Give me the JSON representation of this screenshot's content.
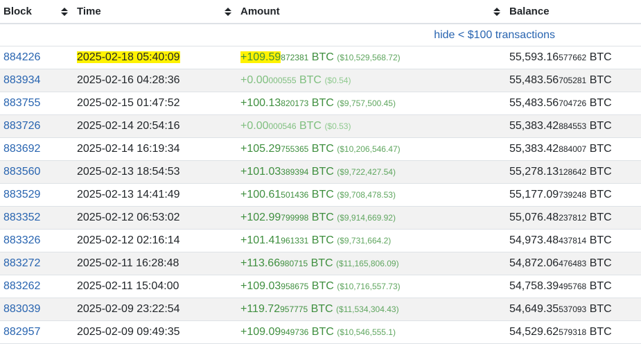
{
  "columns": {
    "block": "Block",
    "time": "Time",
    "amount": "Amount",
    "balance": "Balance"
  },
  "hide_link": "hide < $100 transactions",
  "rows": [
    {
      "block": "884226",
      "time": "2025-02-18 05:40:09",
      "amt_main": "+109.59",
      "amt_small": "872381",
      "unit": "BTC",
      "usd": "($10,529,568.72)",
      "bal_main": "55,593.16",
      "bal_small": "577662",
      "bal_unit": "BTC",
      "highlighted": true
    },
    {
      "block": "883934",
      "time": "2025-02-16 04:28:36",
      "amt_main": "+0.00",
      "amt_small": "000555",
      "unit": "BTC",
      "usd": "($0.54)",
      "bal_main": "55,483.56",
      "bal_small": "705281",
      "bal_unit": "BTC"
    },
    {
      "block": "883755",
      "time": "2025-02-15 01:47:52",
      "amt_main": "+100.13",
      "amt_small": "820173",
      "unit": "BTC",
      "usd": "($9,757,500.45)",
      "bal_main": "55,483.56",
      "bal_small": "704726",
      "bal_unit": "BTC"
    },
    {
      "block": "883726",
      "time": "2025-02-14 20:54:16",
      "amt_main": "+0.00",
      "amt_small": "000546",
      "unit": "BTC",
      "usd": "($0.53)",
      "bal_main": "55,383.42",
      "bal_small": "884553",
      "bal_unit": "BTC"
    },
    {
      "block": "883692",
      "time": "2025-02-14 16:19:34",
      "amt_main": "+105.29",
      "amt_small": "755365",
      "unit": "BTC",
      "usd": "($10,206,546.47)",
      "bal_main": "55,383.42",
      "bal_small": "884007",
      "bal_unit": "BTC"
    },
    {
      "block": "883560",
      "time": "2025-02-13 18:54:53",
      "amt_main": "+101.03",
      "amt_small": "389394",
      "unit": "BTC",
      "usd": "($9,722,427.54)",
      "bal_main": "55,278.13",
      "bal_small": "128642",
      "bal_unit": "BTC"
    },
    {
      "block": "883529",
      "time": "2025-02-13 14:41:49",
      "amt_main": "+100.61",
      "amt_small": "501436",
      "unit": "BTC",
      "usd": "($9,708,478.53)",
      "bal_main": "55,177.09",
      "bal_small": "739248",
      "bal_unit": "BTC"
    },
    {
      "block": "883352",
      "time": "2025-02-12 06:53:02",
      "amt_main": "+102.99",
      "amt_small": "799998",
      "unit": "BTC",
      "usd": "($9,914,669.92)",
      "bal_main": "55,076.48",
      "bal_small": "237812",
      "bal_unit": "BTC"
    },
    {
      "block": "883326",
      "time": "2025-02-12 02:16:14",
      "amt_main": "+101.41",
      "amt_small": "961331",
      "unit": "BTC",
      "usd": "($9,731,664.2)",
      "bal_main": "54,973.48",
      "bal_small": "437814",
      "bal_unit": "BTC"
    },
    {
      "block": "883272",
      "time": "2025-02-11 16:28:48",
      "amt_main": "+113.66",
      "amt_small": "980715",
      "unit": "BTC",
      "usd": "($11,165,806.09)",
      "bal_main": "54,872.06",
      "bal_small": "476483",
      "bal_unit": "BTC"
    },
    {
      "block": "883262",
      "time": "2025-02-11 15:04:00",
      "amt_main": "+109.03",
      "amt_small": "958675",
      "unit": "BTC",
      "usd": "($10,716,557.73)",
      "bal_main": "54,758.39",
      "bal_small": "495768",
      "bal_unit": "BTC"
    },
    {
      "block": "883039",
      "time": "2025-02-09 23:22:54",
      "amt_main": "+119.72",
      "amt_small": "957775",
      "unit": "BTC",
      "usd": "($11,534,304.43)",
      "bal_main": "54,649.35",
      "bal_small": "537093",
      "bal_unit": "BTC"
    },
    {
      "block": "882957",
      "time": "2025-02-09 09:49:35",
      "amt_main": "+109.09",
      "amt_small": "949736",
      "unit": "BTC",
      "usd": "($10,546,555.1)",
      "bal_main": "54,529.62",
      "bal_small": "579318",
      "bal_unit": "BTC"
    }
  ],
  "icons": {
    "sort": "sort-icon"
  },
  "colors": {
    "link": "#2864b0",
    "positive": "#3f8f3f",
    "highlight": "#fff200",
    "stripe": "#f2f2f2"
  }
}
